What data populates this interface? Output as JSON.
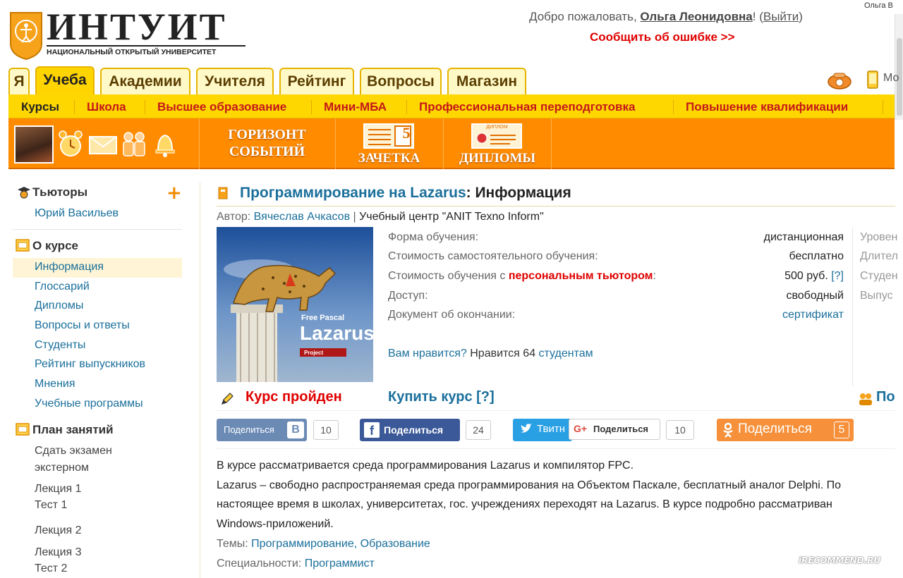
{
  "header": {
    "logo_title": "ИНТУИТ",
    "logo_subtitle": "НАЦИОНАЛЬНЫЙ ОТКРЫТЫЙ УНИВЕРСИТЕТ",
    "welcome_prefix": "Добро пожаловать, ",
    "user_name": "Ольга Леонидовна",
    "welcome_bang": "!",
    "logout_open": " (",
    "logout_label": "Выйти",
    "logout_close": ")",
    "report_error": "Сообщить об ошибке >>",
    "corner_user": "Ольга В",
    "mobile_label": "Мо"
  },
  "tabs": [
    {
      "label": "Я"
    },
    {
      "label": "Учеба"
    },
    {
      "label": "Академии"
    },
    {
      "label": "Учителя"
    },
    {
      "label": "Рейтинг"
    },
    {
      "label": "Вопросы"
    },
    {
      "label": "Магазин"
    }
  ],
  "subnav": [
    {
      "label": "Курсы"
    },
    {
      "label": "Школа"
    },
    {
      "label": "Высшее образование"
    },
    {
      "label": "Мини-МБА"
    },
    {
      "label": "Профессиональная переподготовка"
    },
    {
      "label": "Повышение квалификации"
    }
  ],
  "orange_bar": {
    "horizon_line1": "ГОРИЗОНТ",
    "horizon_line2": "СОБЫТИЙ",
    "zachetka": "ЗАЧЕТКА",
    "zachetka_grade": "5",
    "diplomas": "ДИПЛОМЫ",
    "diploma_tag": "ДИПЛОМ"
  },
  "sidebar": {
    "tutors_heading": "Тьюторы",
    "tutor_name": "Юрий Васильев",
    "about_heading": "О курсе",
    "about_items": [
      {
        "label": "Информация"
      },
      {
        "label": "Глоссарий"
      },
      {
        "label": "Дипломы"
      },
      {
        "label": "Вопросы и ответы"
      },
      {
        "label": "Студенты"
      },
      {
        "label": "Рейтинг выпускников"
      },
      {
        "label": "Мнения"
      },
      {
        "label": "Учебные программы"
      }
    ],
    "plan_heading": "План занятий",
    "plan_items": [
      {
        "line1": "Сдать экзамен",
        "line2": "экстерном"
      },
      {
        "line1": "Лекция 1",
        "line2": "Тест 1"
      },
      {
        "line1": "Лекция 2",
        "line2": ""
      },
      {
        "line1": "Лекция 3",
        "line2": "Тест 2"
      }
    ]
  },
  "course": {
    "title_link": "Программирование на Lazarus",
    "title_rest": ": Информация",
    "author_prefix": "Автор: ",
    "author_name": "Вячеслав Ачкасов",
    "author_sep": " | ",
    "organization": "Учебный центр \"ANIT Texno Inform\"",
    "cover_text1": "Free Pascal",
    "cover_text2": "Lazarus",
    "cover_text3": "Project",
    "info": [
      {
        "label": "Форма обучения:",
        "value": "дистанционная"
      },
      {
        "label": "Стоимость самостоятельного обучения:",
        "value": "бесплатно"
      },
      {
        "label_prefix": "Стоимость обучения с ",
        "label_highlight": "персональным тьютором",
        "label_suffix": ":",
        "value": "500 руб. ",
        "value_link": "[?]"
      },
      {
        "label": "Доступ:",
        "value": "свободный"
      },
      {
        "label": "Документ об окончании:",
        "value": "сертификат"
      }
    ],
    "right_labels": [
      "Уровен",
      "Длител",
      "Студен",
      "Выпус"
    ],
    "likes_question": "Вам нравится?",
    "likes_text": " Нравится ",
    "likes_count": "64",
    "likes_students": " студентам",
    "passed": "Курс пройден",
    "buy": "Купить курс [?]",
    "right_more": "По"
  },
  "share": {
    "vk_label": "Поделиться",
    "vk_count": "10",
    "fb_label": "Поделиться",
    "fb_count": "24",
    "tw_label": "Твитн",
    "gp_label": "Поделиться",
    "gp_count": "10",
    "ok_label": "Поделиться",
    "ok_count": "5"
  },
  "description": {
    "line1": "В курсе рассматривается среда программирования Lazarus и компилятор FPC.",
    "line2": "Lazarus – свободно распространяемая среда программирования на Объектом Паскале, бесплатный аналог Delphi. По",
    "line3": "настоящее время в школах, университетах, гос. учреждениях переходят на Lazarus. В курсе подробно рассматриван",
    "line4": "Windows-приложений.",
    "themes_label": "Темы: ",
    "themes": [
      "Программирование",
      "Образование"
    ],
    "themes_sep": ", ",
    "specialties_label": "Специальности: ",
    "specialty": "Программист"
  },
  "watermark": "iRECOMMEND.RU"
}
